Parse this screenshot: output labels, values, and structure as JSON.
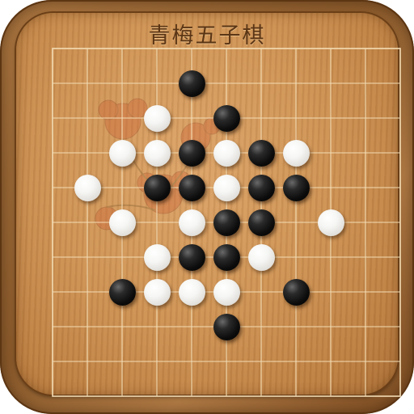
{
  "app": {
    "title": "青梅五子棋"
  },
  "board": {
    "grid_columns": 10,
    "grid_rows": 10,
    "stones": [
      {
        "col": 4,
        "row": 1,
        "color": "black"
      },
      {
        "col": 3,
        "row": 2,
        "color": "white"
      },
      {
        "col": 5,
        "row": 2,
        "color": "black"
      },
      {
        "col": 2,
        "row": 3,
        "color": "white"
      },
      {
        "col": 3,
        "row": 3,
        "color": "white"
      },
      {
        "col": 4,
        "row": 3,
        "color": "black"
      },
      {
        "col": 5,
        "row": 3,
        "color": "white"
      },
      {
        "col": 6,
        "row": 3,
        "color": "black"
      },
      {
        "col": 7,
        "row": 3,
        "color": "white"
      },
      {
        "col": 1,
        "row": 4,
        "color": "white"
      },
      {
        "col": 3,
        "row": 4,
        "color": "black"
      },
      {
        "col": 4,
        "row": 4,
        "color": "black"
      },
      {
        "col": 5,
        "row": 4,
        "color": "white"
      },
      {
        "col": 6,
        "row": 4,
        "color": "black"
      },
      {
        "col": 7,
        "row": 4,
        "color": "black"
      },
      {
        "col": 2,
        "row": 5,
        "color": "white"
      },
      {
        "col": 4,
        "row": 5,
        "color": "white"
      },
      {
        "col": 5,
        "row": 5,
        "color": "black"
      },
      {
        "col": 6,
        "row": 5,
        "color": "black"
      },
      {
        "col": 8,
        "row": 5,
        "color": "white"
      },
      {
        "col": 3,
        "row": 6,
        "color": "white"
      },
      {
        "col": 4,
        "row": 6,
        "color": "black"
      },
      {
        "col": 5,
        "row": 6,
        "color": "black"
      },
      {
        "col": 6,
        "row": 6,
        "color": "white"
      },
      {
        "col": 2,
        "row": 7,
        "color": "black"
      },
      {
        "col": 3,
        "row": 7,
        "color": "white"
      },
      {
        "col": 4,
        "row": 7,
        "color": "white"
      },
      {
        "col": 5,
        "row": 7,
        "color": "white"
      },
      {
        "col": 7,
        "row": 7,
        "color": "black"
      },
      {
        "col": 5,
        "row": 8,
        "color": "black"
      }
    ]
  },
  "colors": {
    "board_wood": "#cf9456",
    "frame_wood": "#8a5a2b",
    "grid_line": "#f3dcb4",
    "title_ink": "#5a3515"
  }
}
